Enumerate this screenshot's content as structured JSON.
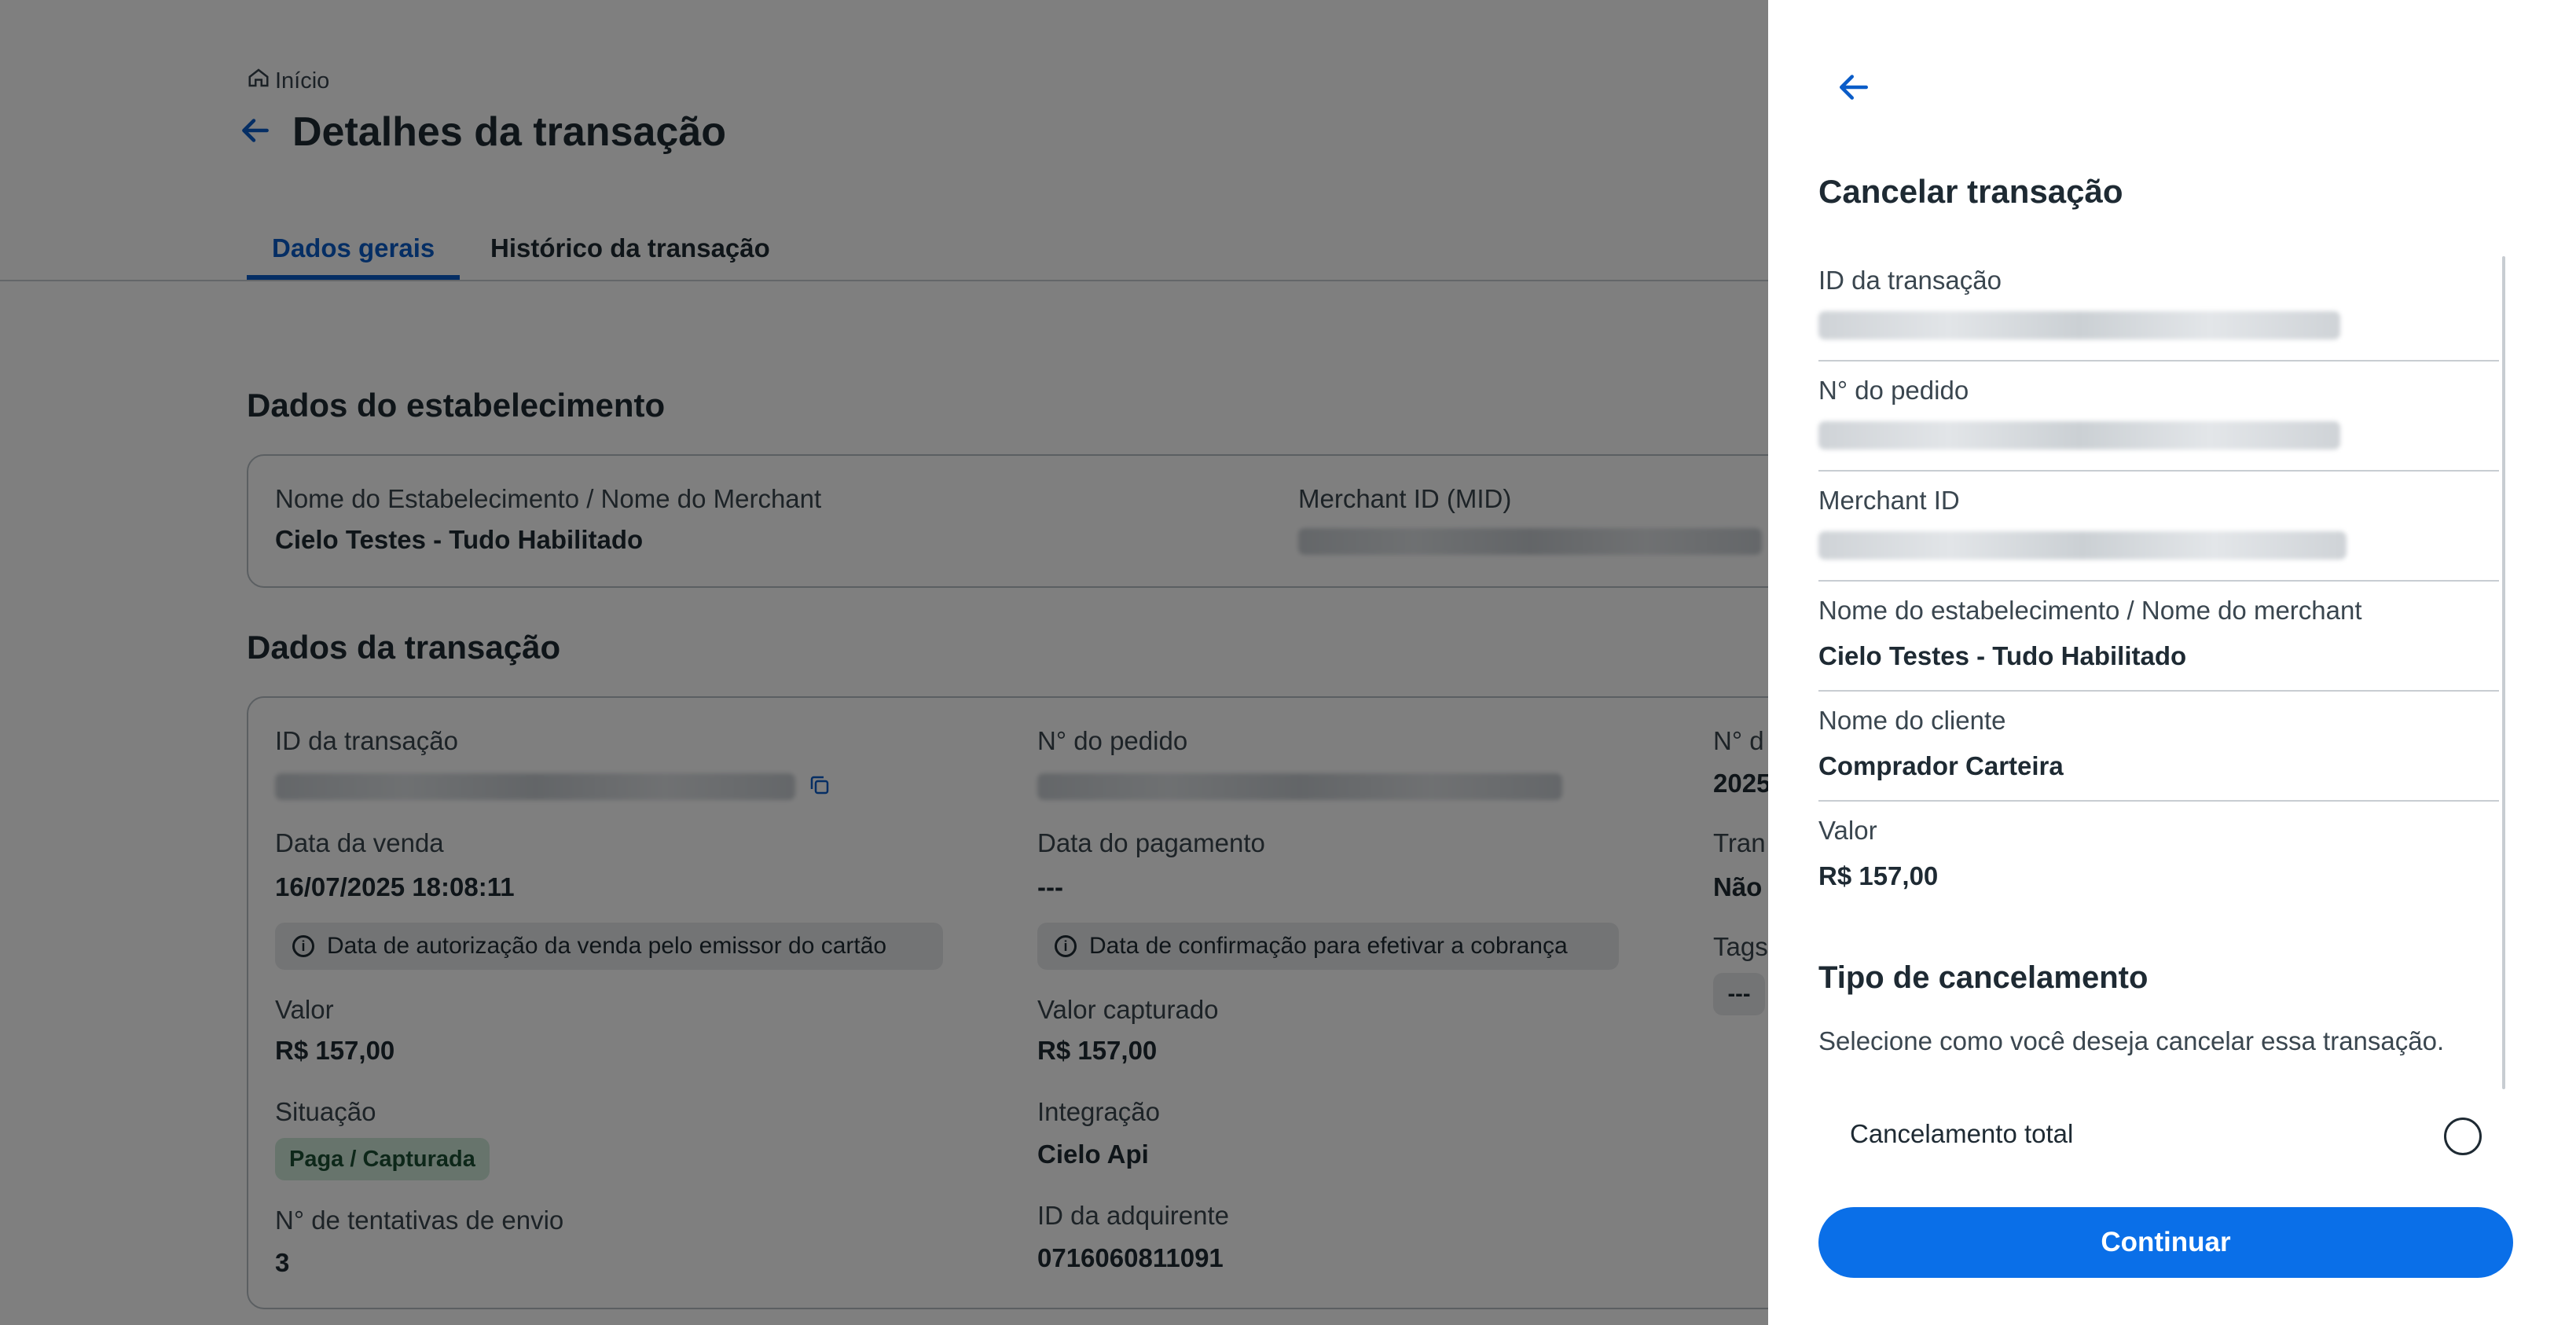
{
  "breadcrumb": {
    "home_label": "Início"
  },
  "page": {
    "title": "Detalhes da transação",
    "tabs": [
      {
        "label": "Dados gerais",
        "active": true
      },
      {
        "label": "Histórico da transação",
        "active": false
      }
    ]
  },
  "establishment": {
    "section_title": "Dados do estabelecimento",
    "name_label": "Nome do Estabelecimento / Nome do Merchant",
    "name_value": "Cielo Testes - Tudo Habilitado",
    "mid_label": "Merchant ID (MID)"
  },
  "transaction": {
    "section_title": "Dados da transação",
    "id_label": "ID da transação",
    "order_label": "N° do pedido",
    "third_col_label": "N° d",
    "third_col_value": "2025",
    "sale_date_label": "Data da venda",
    "sale_date_value": "16/07/2025 18:08:11",
    "sale_date_info": "Data de autorização da venda pelo emissor do cartão",
    "payment_date_label": "Data do pagamento",
    "payment_date_value": "---",
    "payment_date_info": "Data de confirmação para efetivar a cobrança",
    "tran_label": "Tran",
    "tran_value": "Não",
    "tags_label": "Tags",
    "tags_value": "---",
    "value_label": "Valor",
    "value_value": "R$ 157,00",
    "captured_label": "Valor capturado",
    "captured_value": "R$ 157,00",
    "status_label": "Situação",
    "status_value": "Paga / Capturada",
    "integration_label": "Integração",
    "integration_value": "Cielo Api",
    "attempts_label": "N° de tentativas de envio",
    "attempts_value": "3",
    "acquirer_label": "ID da adquirente",
    "acquirer_value": "0716060811091"
  },
  "panel": {
    "title": "Cancelar transação",
    "rows": [
      {
        "label": "ID da transação",
        "value": ""
      },
      {
        "label": "N° do pedido",
        "value": ""
      },
      {
        "label": "Merchant ID",
        "value": ""
      },
      {
        "label": "Nome do estabelecimento / Nome do merchant",
        "value": "Cielo Testes - Tudo Habilitado"
      },
      {
        "label": "Nome do cliente",
        "value": "Comprador Carteira"
      },
      {
        "label": "Valor",
        "value": "R$ 157,00"
      }
    ],
    "cancel_type_title": "Tipo de cancelamento",
    "cancel_type_desc": "Selecione como você deseja cancelar essa transação.",
    "option_total": "Cancelamento total",
    "continue_label": "Continuar"
  },
  "colors": {
    "primary": "#0a6fe8",
    "tab_active": "#0a5cc8",
    "badge_bg": "#cfe8d9"
  }
}
